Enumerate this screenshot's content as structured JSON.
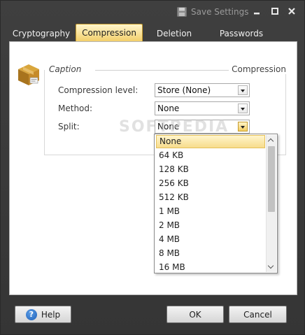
{
  "titlebar": {
    "save_label": "Save Settings",
    "icons": [
      "save-icon",
      "minimize-icon",
      "maximize-icon",
      "close-icon"
    ]
  },
  "tabs": [
    {
      "label": "Cryptography",
      "active": false
    },
    {
      "label": "Compression",
      "active": true
    },
    {
      "label": "Deletion",
      "active": false
    },
    {
      "label": "Passwords",
      "active": false
    }
  ],
  "group": {
    "caption": "Caption",
    "section_title": "Compression",
    "fields": [
      {
        "label": "Compression level:",
        "value": "Store (None)"
      },
      {
        "label": "Method:",
        "value": "None"
      },
      {
        "label": "Split:",
        "value": "None"
      }
    ]
  },
  "split_dropdown": {
    "options": [
      "None",
      "64 KB",
      "128 KB",
      "256 KB",
      "512 KB",
      "1 MB",
      "2 MB",
      "4 MB",
      "8 MB",
      "16 MB"
    ],
    "selected": "None"
  },
  "watermark": "SOFTPEDIA",
  "buttons": {
    "help": "Help",
    "ok": "OK",
    "cancel": "Cancel"
  },
  "colors": {
    "accent": "#f3cf6b",
    "frame": "#3a3a3a"
  }
}
